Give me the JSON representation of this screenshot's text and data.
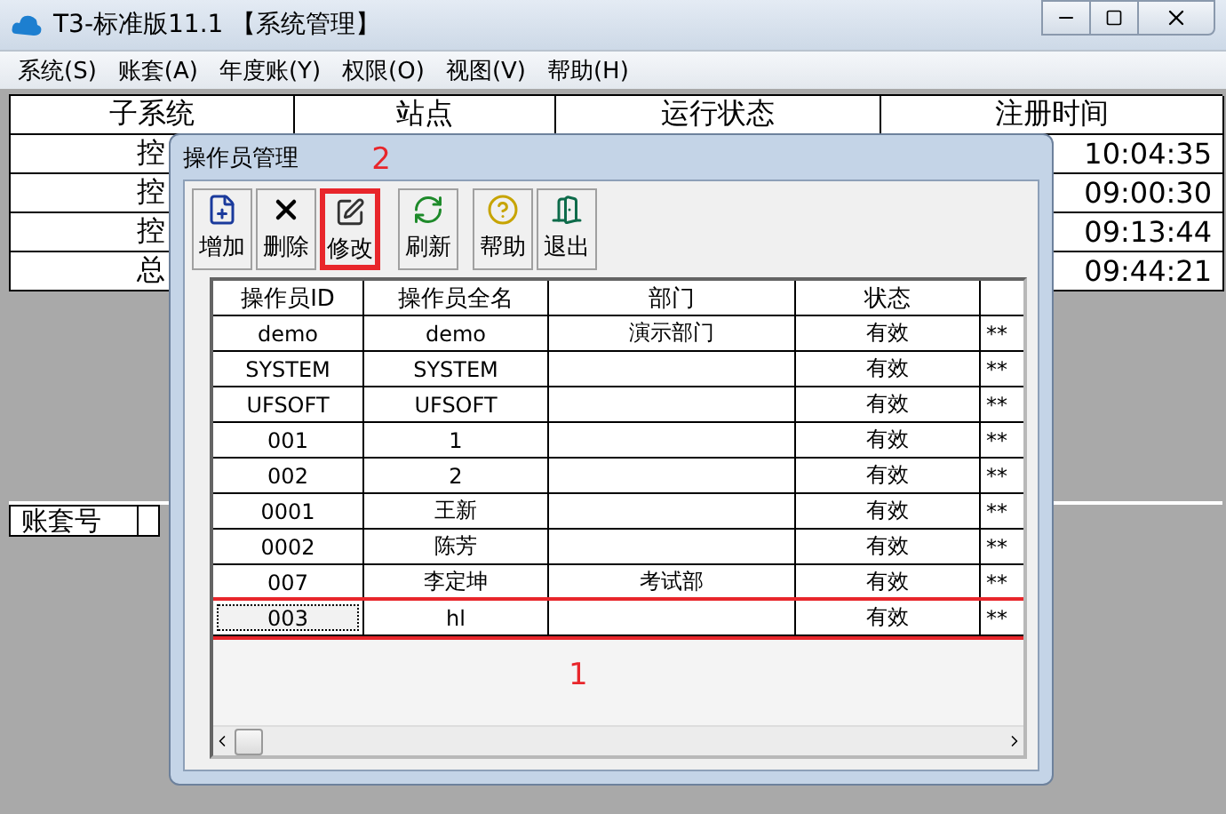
{
  "window": {
    "title": "T3-标准版11.1 【系统管理】"
  },
  "menu": [
    "系统(S)",
    "账套(A)",
    "年度账(Y)",
    "权限(O)",
    "视图(V)",
    "帮助(H)"
  ],
  "subsystems": {
    "columns": [
      "子系统",
      "站点",
      "运行状态",
      "注册时间"
    ],
    "rows": [
      {
        "subsystem": "控",
        "time": "10:04:35"
      },
      {
        "subsystem": "控",
        "time": "09:00:30"
      },
      {
        "subsystem": "控",
        "time": "09:13:44"
      },
      {
        "subsystem": "总",
        "time": "09:44:21"
      }
    ]
  },
  "accounts": {
    "columns": [
      "账套号"
    ]
  },
  "dialog": {
    "title": "操作员管理",
    "tools": [
      {
        "label": "增加",
        "kind": "add",
        "highlighted": false
      },
      {
        "label": "删除",
        "kind": "delete",
        "highlighted": false
      },
      {
        "label": "修改",
        "kind": "edit",
        "highlighted": true,
        "callout": "2"
      },
      {
        "label": "刷新",
        "kind": "refresh",
        "highlighted": false
      },
      {
        "label": "帮助",
        "kind": "help",
        "highlighted": false
      },
      {
        "label": "退出",
        "kind": "exit",
        "highlighted": false
      }
    ],
    "columns": [
      "操作员ID",
      "操作员全名",
      "部门",
      "状态"
    ],
    "rows": [
      {
        "id": "demo",
        "name": "demo",
        "department": "演示部门",
        "status": "有效",
        "password": "**",
        "highlighted": false,
        "focused": false
      },
      {
        "id": "SYSTEM",
        "name": "SYSTEM",
        "status": "有效",
        "password": "**",
        "highlighted": false,
        "focused": false
      },
      {
        "id": "UFSOFT",
        "name": "UFSOFT",
        "status": "有效",
        "password": "**",
        "highlighted": false,
        "focused": false
      },
      {
        "id": "001",
        "name": "1",
        "status": "有效",
        "password": "**",
        "highlighted": false,
        "focused": false
      },
      {
        "id": "002",
        "name": "2",
        "status": "有效",
        "password": "**",
        "highlighted": false,
        "focused": false
      },
      {
        "id": "0001",
        "name": "王新",
        "status": "有效",
        "password": "**",
        "highlighted": false,
        "focused": false
      },
      {
        "id": "0002",
        "name": "陈芳",
        "status": "有效",
        "password": "**",
        "highlighted": false,
        "focused": false
      },
      {
        "id": "007",
        "name": "李定坤",
        "department": "考试部",
        "status": "有效",
        "password": "**",
        "highlighted": false,
        "focused": false
      },
      {
        "id": "003",
        "name": "hl",
        "status": "有效",
        "password": "**",
        "highlighted": true,
        "focused": true,
        "callout": "1"
      }
    ]
  }
}
